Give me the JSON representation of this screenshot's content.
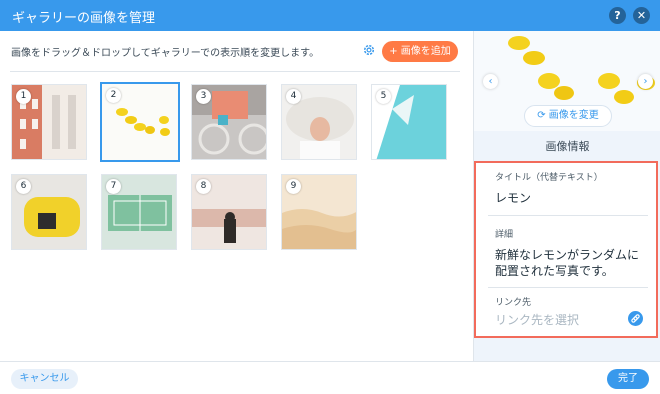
{
  "header": {
    "title": "ギャラリーの画像を管理",
    "help_label": "?",
    "close_label": "✕"
  },
  "toolbar": {
    "instructions": "画像をドラッグ＆ドロップしてギャラリーでの表示順を変更します。",
    "add_label": "+ 画像を追加"
  },
  "gallery": {
    "items": [
      {
        "num": "1"
      },
      {
        "num": "2"
      },
      {
        "num": "3"
      },
      {
        "num": "4"
      },
      {
        "num": "5"
      },
      {
        "num": "6"
      },
      {
        "num": "7"
      },
      {
        "num": "8"
      },
      {
        "num": "9"
      }
    ]
  },
  "preview": {
    "change_label": "画像を変更",
    "prev": "‹",
    "next": "›"
  },
  "info": {
    "header": "画像情報",
    "title_label": "タイトル（代替テキスト）",
    "title_value": "レモン",
    "desc_label": "詳細",
    "desc_value_line1": "新鮮なレモンがランダムに",
    "desc_value_line2": "配置された写真です。",
    "link_label": "リンク先",
    "link_placeholder": "リンク先を選択"
  },
  "footer": {
    "cancel_label": "キャンセル",
    "done_label": "完了"
  },
  "colors": {
    "accent": "#3899ec",
    "add_button": "#ff7a45",
    "highlight": "#f26b5b"
  }
}
